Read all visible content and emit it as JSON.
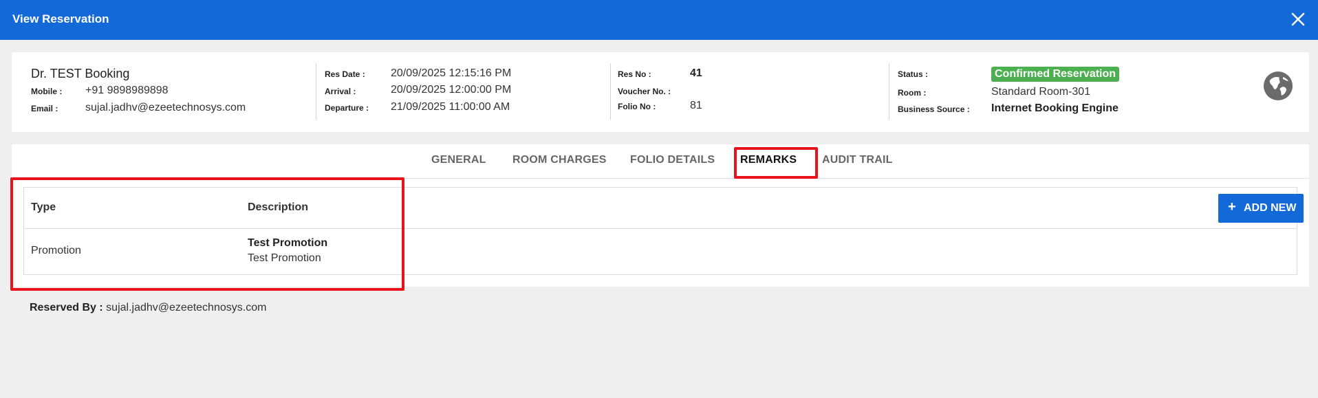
{
  "header": {
    "title": "View Reservation",
    "close_icon": "close-icon"
  },
  "guest": {
    "salutation": "Dr.",
    "name": "TEST Booking",
    "mobile_label": "Mobile :",
    "mobile": "+91 9898989898",
    "email_label": "Email :",
    "email": "sujal.jadhv@ezeetechnosys.com"
  },
  "dates": {
    "res_date_label": "Res Date :",
    "res_date": "20/09/2025 12:15:16 PM",
    "arrival_label": "Arrival :",
    "arrival": "20/09/2025 12:00:00 PM",
    "departure_label": "Departure :",
    "departure": "21/09/2025 11:00:00 AM"
  },
  "reservation": {
    "res_no_label": "Res No :",
    "res_no": "41",
    "voucher_label": "Voucher No. :",
    "voucher": "",
    "folio_label": "Folio No :",
    "folio": "81"
  },
  "status": {
    "status_label": "Status :",
    "status": "Confirmed Reservation",
    "status_color": "#4caf50",
    "room_label": "Room :",
    "room": "Standard Room-301",
    "source_label": "Business Source :",
    "source": "Internet Booking Engine",
    "globe_icon": "globe-icon"
  },
  "tabs": [
    {
      "label": "GENERAL",
      "active": false
    },
    {
      "label": "ROOM CHARGES",
      "active": false
    },
    {
      "label": "FOLIO DETAILS",
      "active": false
    },
    {
      "label": "REMARKS",
      "active": true
    },
    {
      "label": "AUDIT TRAIL",
      "active": false
    }
  ],
  "remarks": {
    "columns": [
      "Type",
      "Description"
    ],
    "add_label": "ADD NEW",
    "rows": [
      {
        "type": "Promotion",
        "title": "Test Promotion",
        "description": "Test Promotion"
      }
    ]
  },
  "footer": {
    "reserved_by_label": "Reserved By :",
    "reserved_by": "sujal.jadhv@ezeetechnosys.com"
  },
  "colors": {
    "accent": "#1469d8",
    "highlight": "#e8131b"
  }
}
